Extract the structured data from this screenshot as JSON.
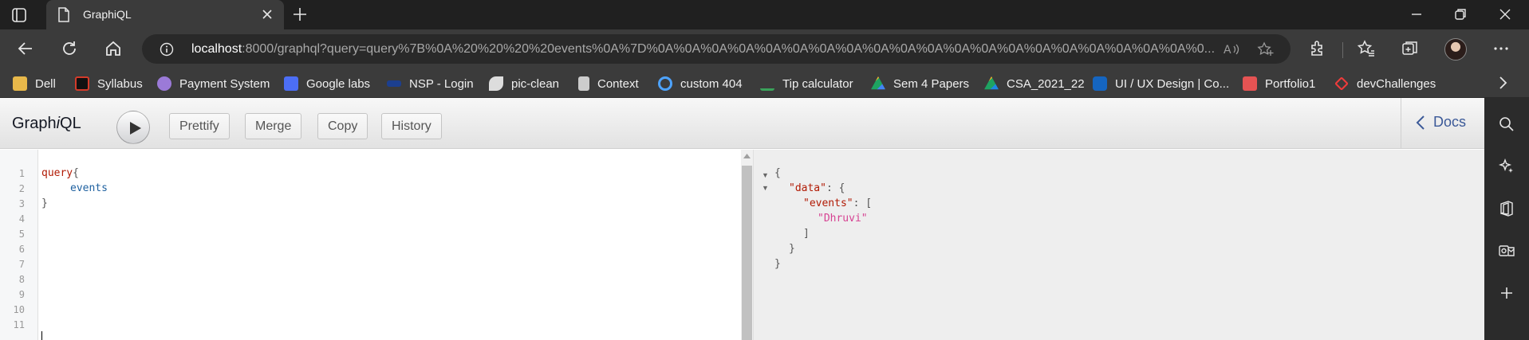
{
  "browser": {
    "tab_title": "GraphiQL",
    "url_host": "localhost",
    "url_rest": ":8000/graphql?query=query%7B%0A%20%20%20%20events%0A%7D%0A%0A%0A%0A%0A%0A%0A%0A%0A%0A%0A%0A%0A%0A%0A%0A%0A%0A%0A%0A%0..."
  },
  "bookmarks": [
    {
      "label": "Dell",
      "icon": "folder-icon",
      "color": "#e8b84a"
    },
    {
      "label": "Syllabus",
      "icon": "syllabus-icon",
      "color": "#d43b2a"
    },
    {
      "label": "Payment System",
      "icon": "payment-icon",
      "color": "#9b7ad8"
    },
    {
      "label": "Google labs",
      "icon": "labs-icon",
      "color": "#4c6ef5"
    },
    {
      "label": "NSP - Login",
      "icon": "nsp-icon",
      "color": "#1c3f8f"
    },
    {
      "label": "pic-clean",
      "icon": "pic-icon",
      "color": "#dddddd"
    },
    {
      "label": "Context",
      "icon": "page-icon",
      "color": "#cccccc"
    },
    {
      "label": "custom 404",
      "icon": "link-icon",
      "color": "#4da3ff"
    },
    {
      "label": "Tip calculator",
      "icon": "tip-icon",
      "color": "#3aa35b"
    },
    {
      "label": "Sem 4 Papers",
      "icon": "drive-icon",
      "color": "#f3b82b"
    },
    {
      "label": "CSA_2021_22",
      "icon": "drive-icon",
      "color": "#1e88e5"
    },
    {
      "label": "UI / UX Design | Co...",
      "icon": "coursera-icon",
      "color": "#1565c0"
    },
    {
      "label": "Portfolio1",
      "icon": "portfolio-icon",
      "color": "#e55353"
    },
    {
      "label": "devChallenges",
      "icon": "dev-icon",
      "color": "#ef3b3b"
    }
  ],
  "graphiql": {
    "title_prefix": "Graph",
    "title_i": "i",
    "title_suffix": "QL",
    "buttons": {
      "prettify": "Prettify",
      "merge": "Merge",
      "copy": "Copy",
      "history": "History"
    },
    "docs_label": "Docs",
    "line_numbers": [
      "1",
      "2",
      "3",
      "4",
      "5",
      "6",
      "7",
      "8",
      "9",
      "10",
      "11"
    ],
    "query": {
      "keyword": "query",
      "open_brace": "{",
      "field": "events",
      "close_brace": "}"
    },
    "result": {
      "l1": "{",
      "data_key": "\"data\"",
      "data_sep": ": {",
      "events_key": "\"events\"",
      "events_sep": ": [",
      "value": "\"Dhruvi\"",
      "close_bracket": "]",
      "close_inner": "}",
      "close_outer": "}"
    }
  }
}
